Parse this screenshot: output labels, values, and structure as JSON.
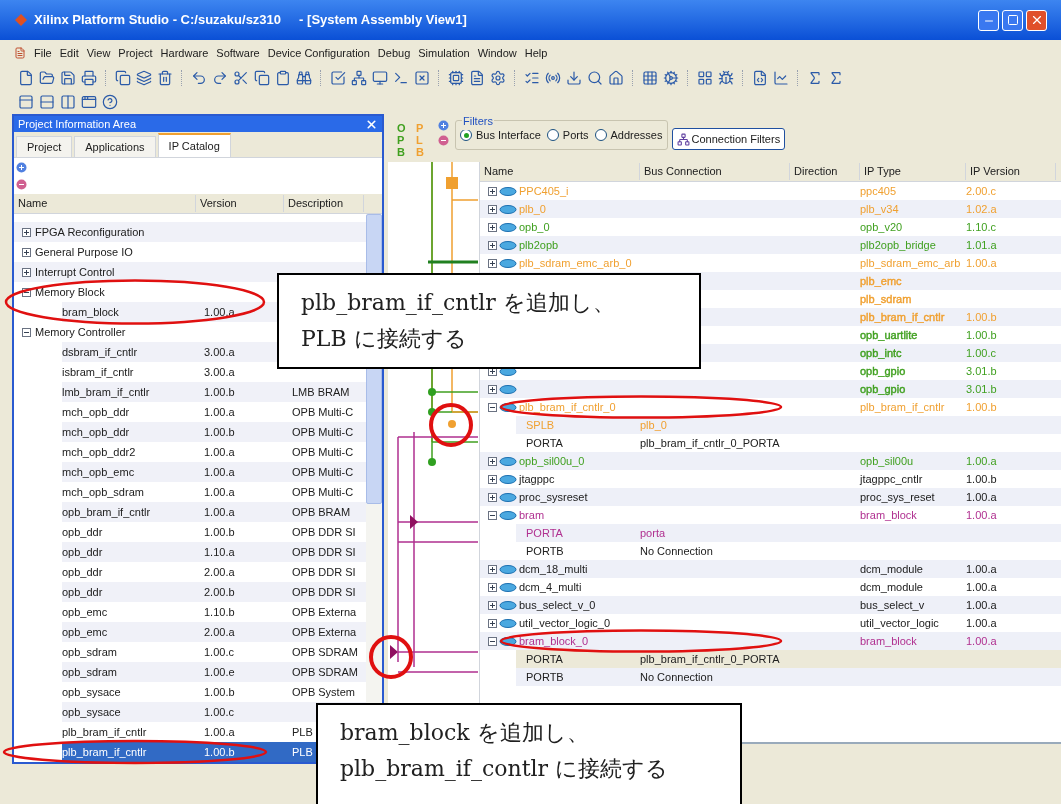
{
  "window": {
    "title": "Xilinx Platform Studio - C:/suzaku/sz310     - [System Assembly View1]"
  },
  "menu": [
    "File",
    "Edit",
    "View",
    "Project",
    "Hardware",
    "Software",
    "Device Configuration",
    "Debug",
    "Simulation",
    "Window",
    "Help"
  ],
  "project_panel": {
    "title": "Project Information Area",
    "tabs": [
      {
        "label": "Project",
        "selected": false
      },
      {
        "label": "Applications",
        "selected": false
      },
      {
        "label": "IP Catalog",
        "selected": true
      }
    ],
    "columns": [
      "Name",
      "Version",
      "Description"
    ],
    "tree": [
      {
        "name": "FPGA Reconfiguration",
        "expanded": false
      },
      {
        "name": "General Purpose IO",
        "expanded": false
      },
      {
        "name": "Interrupt Control",
        "expanded": false
      },
      {
        "name": "Memory Block",
        "expanded": true,
        "children": [
          {
            "name": "bram_block",
            "version": "1.00.a",
            "selected": false
          }
        ]
      },
      {
        "name": "Memory Controller",
        "expanded": true,
        "children": [
          {
            "name": "dsbram_if_cntlr",
            "version": "3.00.a",
            "selected": false
          },
          {
            "name": "isbram_if_cntlr",
            "version": "3.00.a",
            "selected": false
          },
          {
            "name": "lmb_bram_if_cntlr",
            "version": "1.00.b",
            "description": "LMB BRAM",
            "selected": false
          },
          {
            "name": "mch_opb_ddr",
            "version": "1.00.a",
            "description": "OPB Multi-C",
            "selected": false
          },
          {
            "name": "mch_opb_ddr",
            "version": "1.00.b",
            "description": "OPB Multi-C",
            "selected": false
          },
          {
            "name": "mch_opb_ddr2",
            "version": "1.00.a",
            "description": "OPB Multi-C",
            "selected": false
          },
          {
            "name": "mch_opb_emc",
            "version": "1.00.a",
            "description": "OPB Multi-C",
            "selected": false
          },
          {
            "name": "mch_opb_sdram",
            "version": "1.00.a",
            "description": "OPB Multi-C",
            "selected": false
          },
          {
            "name": "opb_bram_if_cntlr",
            "version": "1.00.a",
            "description": "OPB BRAM",
            "selected": false
          },
          {
            "name": "opb_ddr",
            "version": "1.00.b",
            "description": "OPB DDR SI",
            "selected": false
          },
          {
            "name": "opb_ddr",
            "version": "1.10.a",
            "description": "OPB DDR SI",
            "selected": false
          },
          {
            "name": "opb_ddr",
            "version": "2.00.a",
            "description": "OPB DDR SI",
            "selected": false
          },
          {
            "name": "opb_ddr",
            "version": "2.00.b",
            "description": "OPB DDR SI",
            "selected": false
          },
          {
            "name": "opb_emc",
            "version": "1.10.b",
            "description": "OPB Externa",
            "selected": false
          },
          {
            "name": "opb_emc",
            "version": "2.00.a",
            "description": "OPB Externa",
            "selected": false
          },
          {
            "name": "opb_sdram",
            "version": "1.00.c",
            "description": "OPB SDRAM",
            "selected": false
          },
          {
            "name": "opb_sdram",
            "version": "1.00.e",
            "description": "OPB SDRAM",
            "selected": false
          },
          {
            "name": "opb_sysace",
            "version": "1.00.b",
            "description": "OPB System",
            "selected": false
          },
          {
            "name": "opb_sysace",
            "version": "1.00.c",
            "selected": false
          },
          {
            "name": "plb_bram_if_cntlr",
            "version": "1.00.a",
            "description": "PLB",
            "selected": false
          },
          {
            "name": "plb_bram_if_cntlr",
            "version": "1.00.b",
            "description": "PLB",
            "selected": true
          }
        ]
      }
    ]
  },
  "filters": {
    "title": "Filters",
    "options": [
      {
        "label": "Bus Interface",
        "selected": true
      },
      {
        "label": "Ports",
        "selected": false
      },
      {
        "label": "Addresses",
        "selected": false
      }
    ],
    "button": "Connection Filters"
  },
  "bus_labels": [
    "OPB",
    "PLB"
  ],
  "assembly_table": {
    "columns": [
      "Name",
      "Bus Connection",
      "Direction",
      "IP Type",
      "IP Version"
    ],
    "rows": [
      {
        "name": "PPC405_i",
        "ip_type": "ppc405",
        "ip_version": "2.00.c",
        "color": "#f0a030",
        "expanded": false
      },
      {
        "name": "plb_0",
        "ip_type": "plb_v34",
        "ip_version": "1.02.a",
        "color": "#f0a030",
        "expanded": false
      },
      {
        "name": "opb_0",
        "ip_type": "opb_v20",
        "ip_version": "1.10.c",
        "color": "#40a020",
        "expanded": false
      },
      {
        "name": "plb2opb",
        "ip_type": "plb2opb_bridge",
        "ip_version": "1.01.a",
        "color": "#40a020",
        "expanded": false
      },
      {
        "name": "plb_sdram_emc_arb_0",
        "ip_type": "plb_sdram_emc_arb",
        "ip_version": "1.00.a",
        "color": "#f0a030",
        "expanded": false
      },
      {
        "ip_type": "plb_emc",
        "color": "#f0a030"
      },
      {
        "ip_type": "plb_sdram",
        "color": "#f0a030"
      },
      {
        "ip_type": "plb_bram_if_cntlr",
        "ip_version": "1.00.b",
        "color": "#f0a030"
      },
      {
        "ip_type": "opb_uartlite",
        "ip_version": "1.00.b",
        "color": "#40a020"
      },
      {
        "ip_type": "opb_intc",
        "ip_version": "1.00.c",
        "color": "#40a020"
      },
      {
        "ip_type": "opb_gpio",
        "ip_version": "3.01.b",
        "color": "#40a020",
        "expanded": false
      },
      {
        "ip_type": "opb_gpio",
        "ip_version": "3.01.b",
        "color": "#40a020",
        "expanded": false
      },
      {
        "name": "plb_bram_if_cntlr_0",
        "ip_type": "plb_bram_if_cntlr",
        "ip_version": "1.00.b",
        "color": "#f0a030",
        "expanded": true,
        "children": [
          {
            "name": "SPLB",
            "bus": "plb_0",
            "color": "#f0a030",
            "selected": false
          },
          {
            "name": "PORTA",
            "bus": "plb_bram_if_cntlr_0_PORTA",
            "color": "#202020",
            "selected": false
          }
        ]
      },
      {
        "name": "opb_sil00u_0",
        "ip_type": "opb_sil00u",
        "ip_version": "1.00.a",
        "color": "#40a020",
        "expanded": false
      },
      {
        "name": "jtagppc",
        "ip_type": "jtagppc_cntlr",
        "ip_version": "1.00.b",
        "color": "#202020",
        "expanded": false
      },
      {
        "name": "proc_sysreset",
        "ip_type": "proc_sys_reset",
        "ip_version": "1.00.a",
        "color": "#202020",
        "expanded": false
      },
      {
        "name": "bram",
        "ip_type": "bram_block",
        "ip_version": "1.00.a",
        "color": "#b03090",
        "expanded": true,
        "children": [
          {
            "name": "PORTA",
            "bus": "porta",
            "color": "#b03090",
            "selected": false
          },
          {
            "name": "PORTB",
            "bus": "No Connection",
            "color": "#202020",
            "selected": false
          }
        ]
      },
      {
        "name": "dcm_18_multi",
        "ip_type": "dcm_module",
        "ip_version": "1.00.a",
        "color": "#202020",
        "expanded": false
      },
      {
        "name": "dcm_4_multi",
        "ip_type": "dcm_module",
        "ip_version": "1.00.a",
        "color": "#202020",
        "expanded": false
      },
      {
        "name": "bus_select_v_0",
        "ip_type": "bus_select_v",
        "ip_version": "1.00.a",
        "color": "#202020",
        "expanded": false
      },
      {
        "name": "util_vector_logic_0",
        "ip_type": "util_vector_logic",
        "ip_version": "1.00.a",
        "color": "#202020",
        "expanded": false
      },
      {
        "name": "bram_block_0",
        "ip_type": "bram_block",
        "ip_version": "1.00.a",
        "color": "#b03090",
        "expanded": true,
        "children": [
          {
            "name": "PORTA",
            "bus": "plb_bram_if_cntlr_0_PORTA",
            "color": "#202020",
            "selected": true
          },
          {
            "name": "PORTB",
            "bus": "No Connection",
            "color": "#202020",
            "selected": false
          }
        ]
      }
    ]
  },
  "callouts": [
    {
      "lines": [
        "plb_bram_if_cntlr を追加し、",
        "PLB に接続する"
      ]
    },
    {
      "lines": [
        "bram_block を追加し、",
        "plb_bram_if_contlr に接続する"
      ]
    }
  ]
}
